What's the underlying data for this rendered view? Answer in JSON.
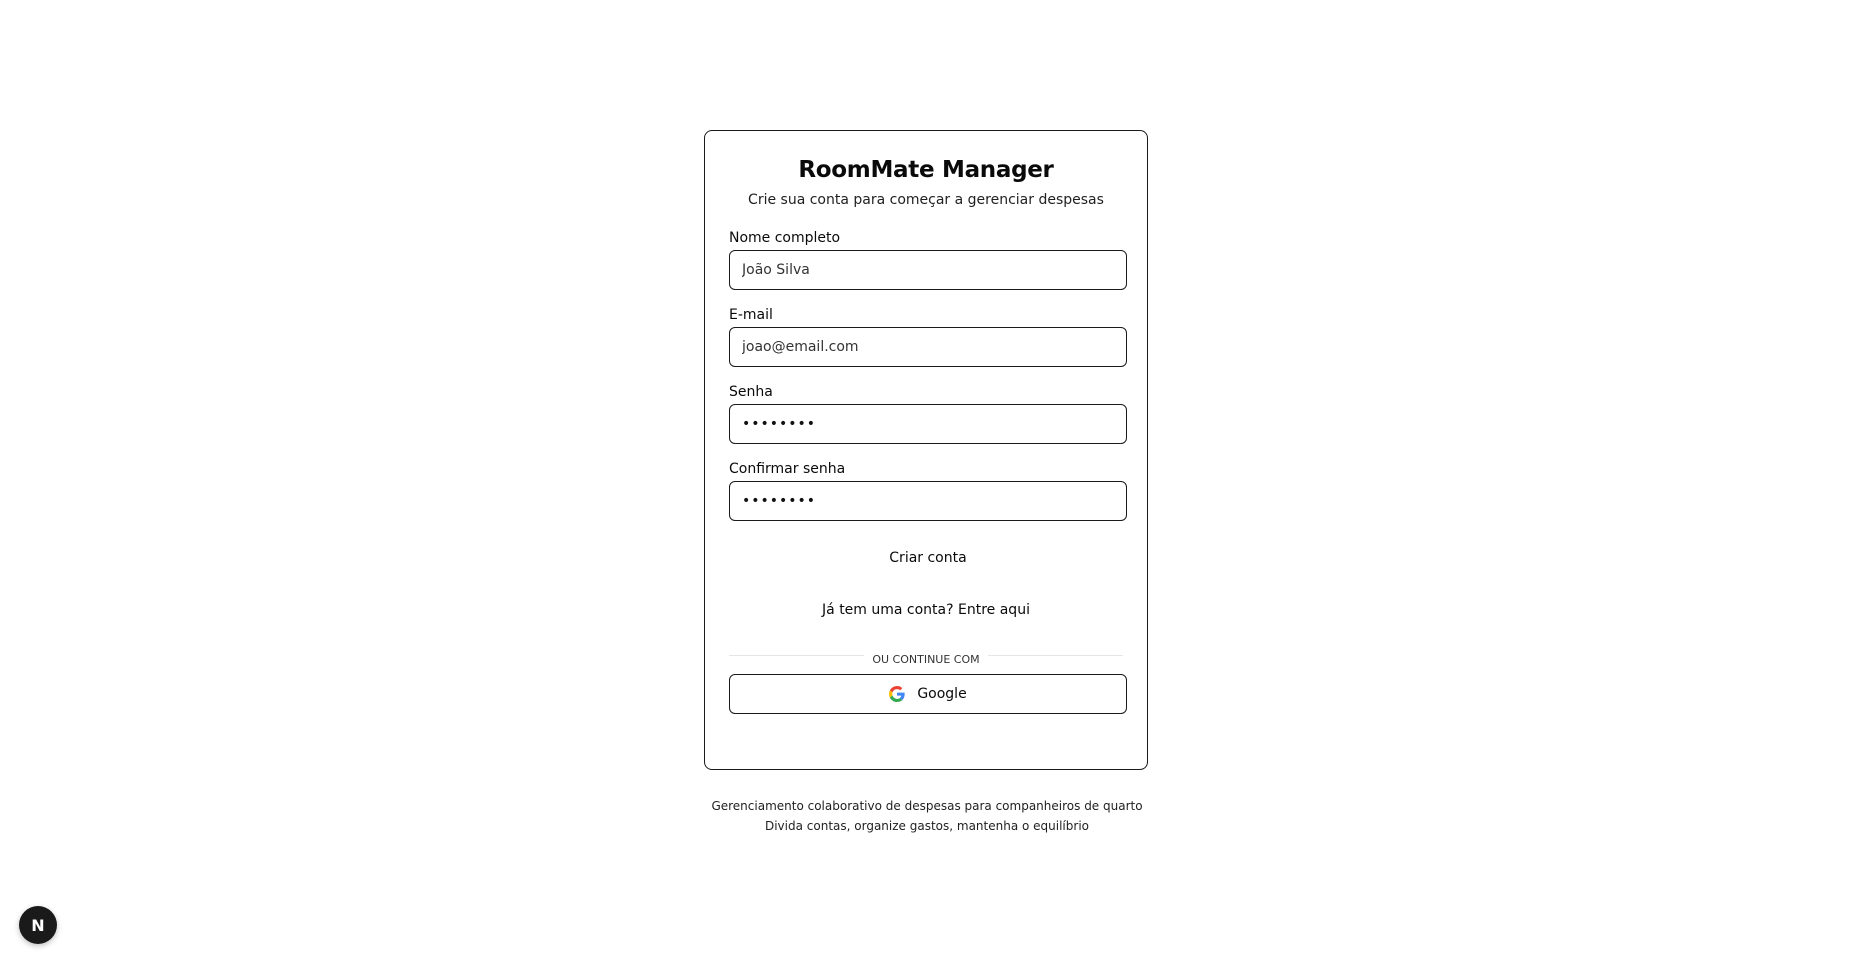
{
  "header": {
    "title": "RoomMate Manager",
    "subtitle": "Crie sua conta para começar a gerenciar despesas"
  },
  "form": {
    "name": {
      "label": "Nome completo",
      "placeholder": "João Silva",
      "value": ""
    },
    "email": {
      "label": "E-mail",
      "placeholder": "joao@email.com",
      "value": ""
    },
    "password": {
      "label": "Senha",
      "placeholder": "••••••••",
      "value": ""
    },
    "confirm_password": {
      "label": "Confirmar senha",
      "placeholder": "••••••••",
      "value": ""
    },
    "submit_label": "Criar conta"
  },
  "login": {
    "text": "Já tem uma conta? Entre aqui"
  },
  "divider": {
    "text": "OU CONTINUE COM"
  },
  "google": {
    "label": "Google",
    "icon": "google-icon"
  },
  "footer": {
    "line1": "Gerenciamento colaborativo de despesas para companheiros de quarto",
    "line2": "Divida contas, organize gastos, mantenha o equilíbrio"
  },
  "dev_badge": {
    "letter": "N",
    "icon": "nextjs-icon"
  },
  "colors": {
    "border": "#1a1a1a",
    "background": "#ffffff",
    "text": "#0a0a0a",
    "divider": "#e6e6e6",
    "badge": "#1a1a1a"
  }
}
